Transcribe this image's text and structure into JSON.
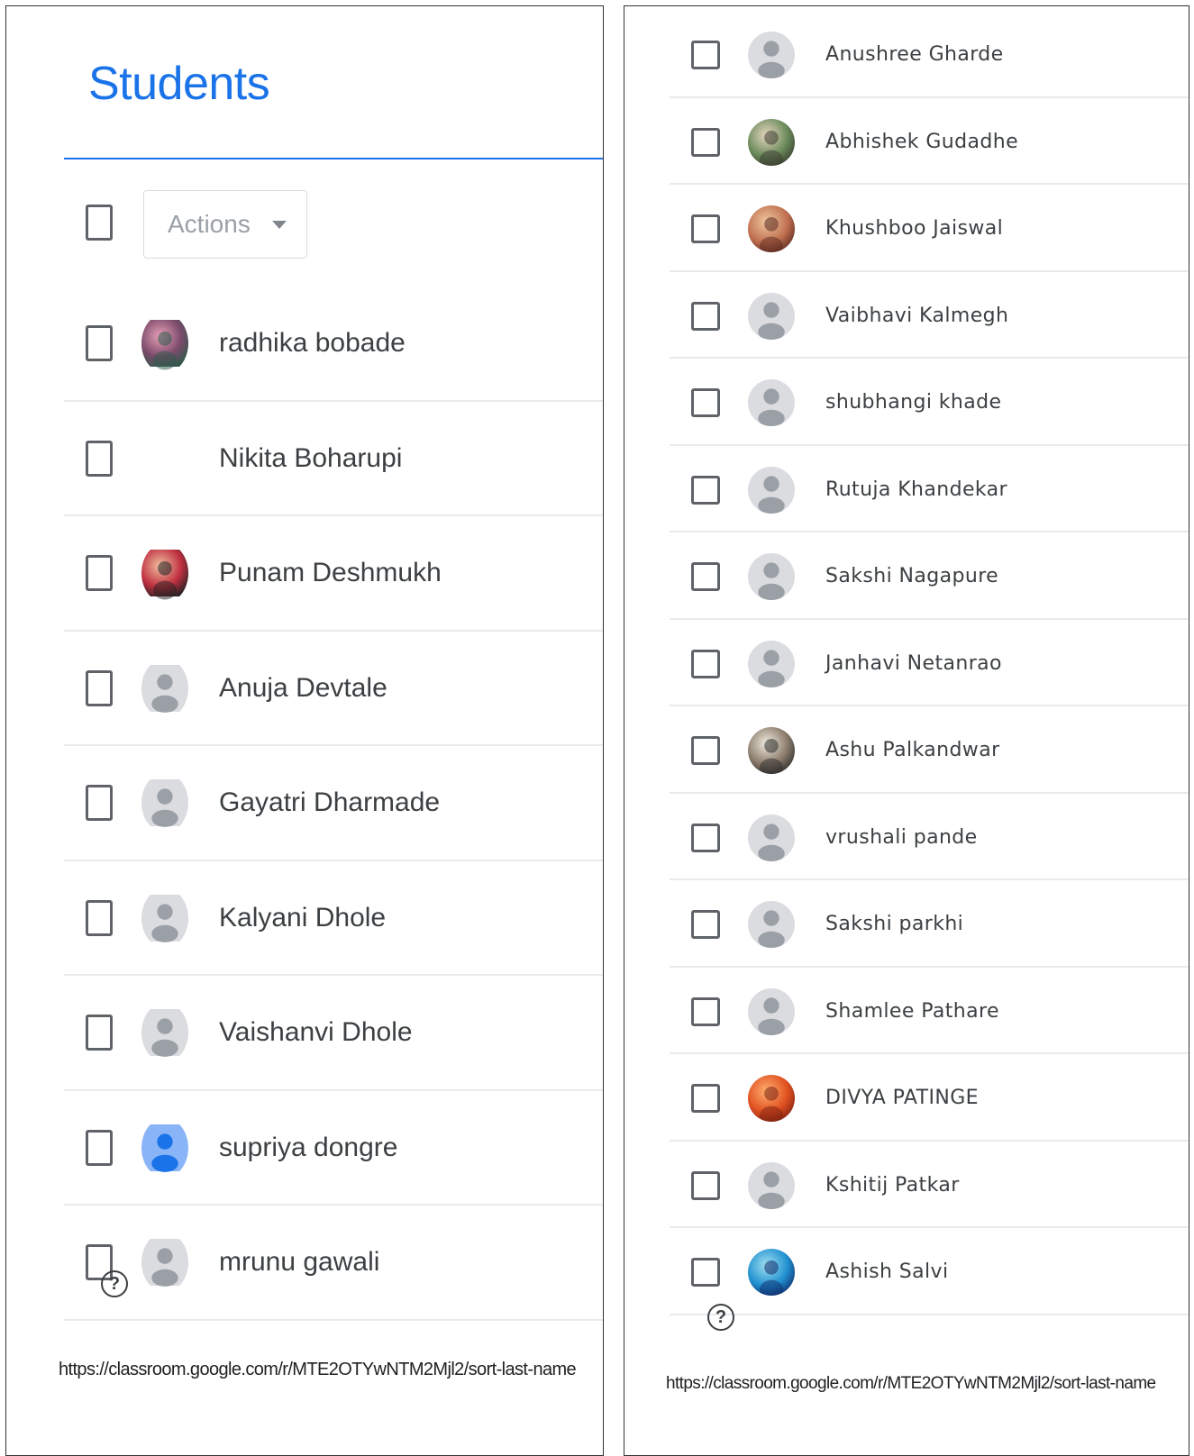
{
  "header": {
    "title": "Students"
  },
  "toolbar": {
    "actions_label": "Actions"
  },
  "help": {
    "symbol": "?"
  },
  "left_panel": {
    "url": "https://classroom.google.com/r/MTE2OTYwNTM2Mjl2/sort-last-name",
    "students": [
      {
        "name": "radhika bobade",
        "avatar": "photo-pink"
      },
      {
        "name": "Nikita Boharupi",
        "avatar": "none"
      },
      {
        "name": "Punam Deshmukh",
        "avatar": "photo-red"
      },
      {
        "name": "Anuja Devtale",
        "avatar": "default"
      },
      {
        "name": "Gayatri Dharmade",
        "avatar": "default"
      },
      {
        "name": "Kalyani Dhole",
        "avatar": "default"
      },
      {
        "name": "Vaishanvi Dhole",
        "avatar": "default"
      },
      {
        "name": "supriya dongre",
        "avatar": "default-blue"
      },
      {
        "name": "mrunu gawali",
        "avatar": "default"
      }
    ]
  },
  "right_panel": {
    "url": "https://classroom.google.com/r/MTE2OTYwNTM2Mjl2/sort-last-name",
    "students": [
      {
        "name": "Anushree Gharde",
        "avatar": "default"
      },
      {
        "name": "Abhishek Gudadhe",
        "avatar": "photo-green"
      },
      {
        "name": "Khushboo Jaiswal",
        "avatar": "photo-warm"
      },
      {
        "name": "Vaibhavi Kalmegh",
        "avatar": "default"
      },
      {
        "name": "shubhangi khade",
        "avatar": "default"
      },
      {
        "name": "Rutuja Khandekar",
        "avatar": "default"
      },
      {
        "name": "Sakshi Nagapure",
        "avatar": "default"
      },
      {
        "name": "Janhavi Netanrao",
        "avatar": "default"
      },
      {
        "name": "Ashu Palkandwar",
        "avatar": "photo-outdoor"
      },
      {
        "name": "vrushali pande",
        "avatar": "default"
      },
      {
        "name": "Sakshi parkhi",
        "avatar": "default"
      },
      {
        "name": "Shamlee Pathare",
        "avatar": "default"
      },
      {
        "name": "DIVYA PATINGE",
        "avatar": "photo-flower"
      },
      {
        "name": "Kshitij Patkar",
        "avatar": "default"
      },
      {
        "name": "Ashish Salvi",
        "avatar": "photo-blue"
      }
    ]
  },
  "colors": {
    "accent": "#1a73e8",
    "avatar_default_bg": "#dadce0",
    "avatar_default_fg": "#9aa0a6",
    "avatar_blue_bg": "#8ab4f8",
    "avatar_blue_fg": "#1a73e8"
  }
}
